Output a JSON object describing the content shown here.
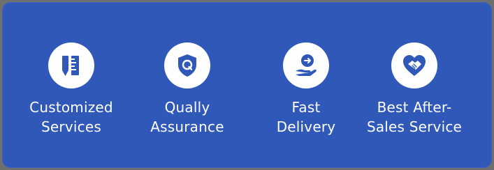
{
  "colors": {
    "panel": "#2f58b8",
    "icon_bg": "#ffffff",
    "icon_fg": "#2f58b8",
    "text": "#ffffff"
  },
  "features": [
    {
      "icon": "ruler-pencil-icon",
      "line1": "Customized",
      "line2": "Services"
    },
    {
      "icon": "shield-q-icon",
      "line1": "Qually",
      "line2": "Assurance"
    },
    {
      "icon": "hand-arrow-icon",
      "line1": "Fast",
      "line2": "Delivery"
    },
    {
      "icon": "heart-handshake-icon",
      "line1": "Best After-",
      "line2": "Sales Service"
    }
  ]
}
